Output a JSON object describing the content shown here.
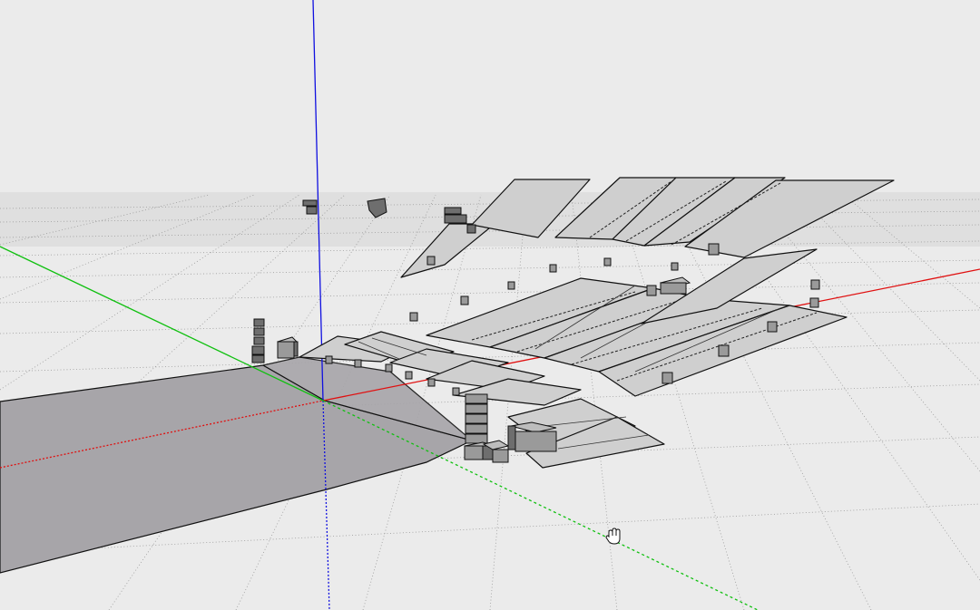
{
  "viewport": {
    "background": "#ebebeb",
    "axes": {
      "red": "#e01010",
      "green": "#10c010",
      "blue": "#1010e0"
    },
    "ground_plane_color": "#a7a5a9",
    "face_color": "#cfcfcf",
    "edge_color": "#111111"
  },
  "cursor": {
    "icon": "hand-pan-icon"
  }
}
